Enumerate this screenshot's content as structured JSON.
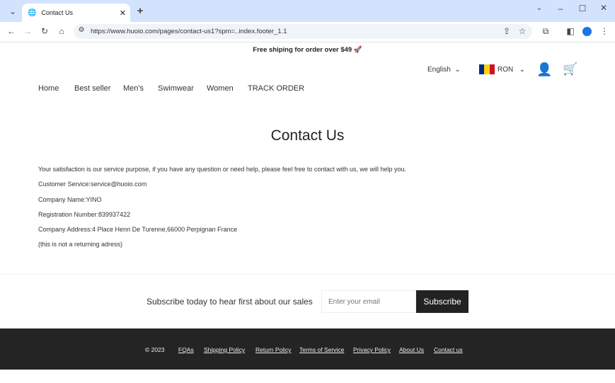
{
  "browser": {
    "tab_title": "Contact Us",
    "url": "https://www.huoio.com/pages/contact-us1?spm=..index.footer_1.1"
  },
  "announcement": "Free shiping for order over $49",
  "header": {
    "language": "English",
    "currency": "RON",
    "nav": [
      "Home",
      "Best seller",
      "Men's",
      "Swimwear",
      "Women",
      "TRACK ORDER"
    ]
  },
  "page": {
    "title": "Contact Us",
    "lines": [
      "Your satisfaction is our service purpose, if you have any question or need help, please feel free to contact with us, we will help you.",
      "Customer Service:service@huoio.com",
      "Company Name:YINO",
      "Registration Number:839937422",
      "Company Address:4 Place Henri De Turenne,66000 Perpignan France",
      "(this is not a returning adress)"
    ]
  },
  "newsletter": {
    "text": "Subscribe today to hear first about our sales",
    "placeholder": "Enter your email",
    "button": "Subscribe"
  },
  "footer": {
    "copyright": "© 2023",
    "links": [
      "FQAs",
      "Shipping Policy",
      "Return Policy",
      "Terms of Service",
      "Privacy Policy",
      "About Us",
      "Contact us"
    ]
  },
  "colors": {
    "tabbar": "#d3e3fd",
    "footer": "#242424",
    "button": "#222222"
  }
}
